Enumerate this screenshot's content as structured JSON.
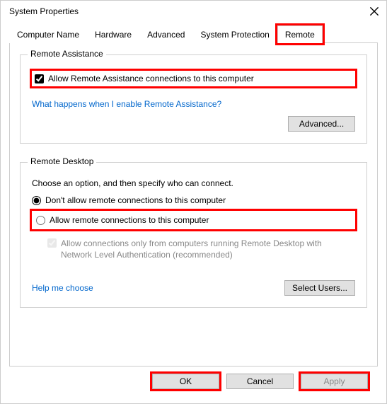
{
  "window": {
    "title": "System Properties"
  },
  "tabs": {
    "computer_name": "Computer Name",
    "hardware": "Hardware",
    "advanced": "Advanced",
    "system_protection": "System Protection",
    "remote": "Remote"
  },
  "remote_assistance": {
    "legend": "Remote Assistance",
    "allow_label": "Allow Remote Assistance connections to this computer",
    "allow_checked": true,
    "help_link": "What happens when I enable Remote Assistance?",
    "advanced_btn": "Advanced..."
  },
  "remote_desktop": {
    "legend": "Remote Desktop",
    "instruction": "Choose an option, and then specify who can connect.",
    "opt_deny": "Don't allow remote connections to this computer",
    "opt_allow": "Allow remote connections to this computer",
    "selected": "deny",
    "nla_label": "Allow connections only from computers running Remote Desktop with Network Level Authentication (recommended)",
    "nla_checked": true,
    "help_link": "Help me choose",
    "select_users_btn": "Select Users..."
  },
  "footer": {
    "ok": "OK",
    "cancel": "Cancel",
    "apply": "Apply"
  }
}
